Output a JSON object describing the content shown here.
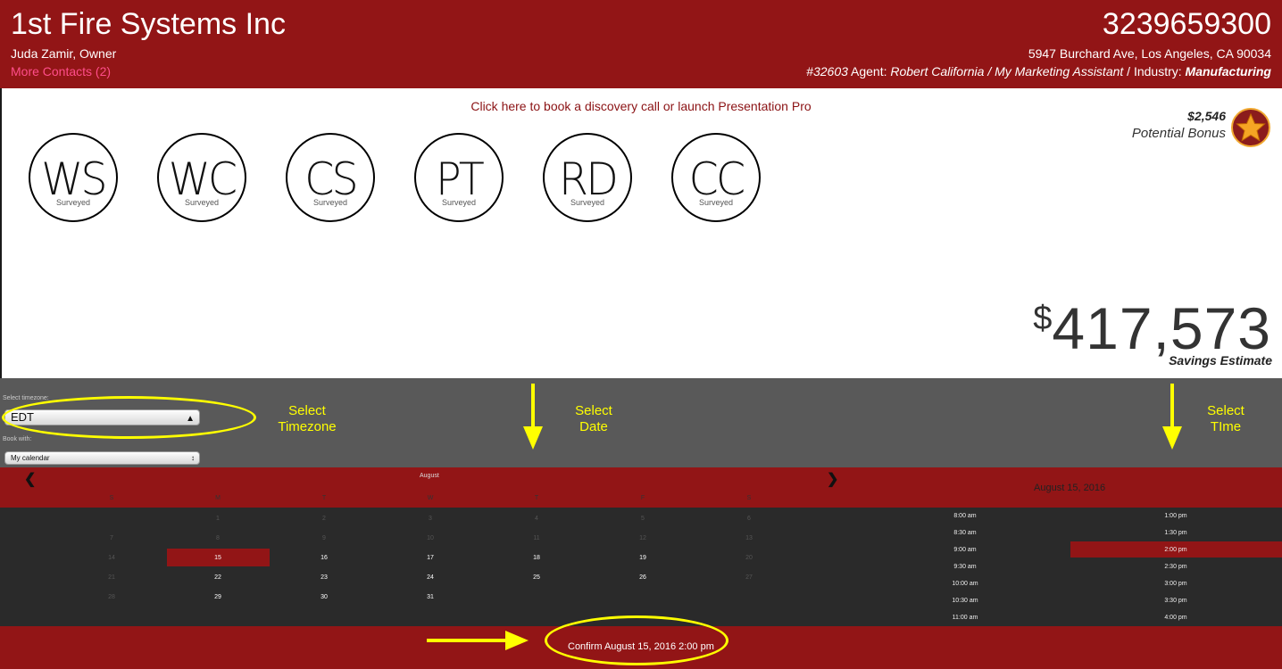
{
  "header": {
    "company_name": "1st Fire Systems Inc",
    "owner": "Juda Zamir, Owner",
    "more_contacts": "More Contacts (2)",
    "phone": "3239659300",
    "address": "5947 Burchard Ave, Los Angeles, CA 90034",
    "account_id": "#32603",
    "agent_label": " Agent: ",
    "agent_name": "Robert California / My Marketing Assistant",
    "industry_label": " / Industry: ",
    "industry": "Manufacturing"
  },
  "discovery_link": "Click here to book a discovery call or launch Presentation Pro",
  "bonus": {
    "amount": "$2,546",
    "label": "Potential Bonus"
  },
  "services": [
    {
      "abbr": "WS",
      "status": "Surveyed"
    },
    {
      "abbr": "WC",
      "status": "Surveyed"
    },
    {
      "abbr": "CS",
      "status": "Surveyed"
    },
    {
      "abbr": "PT",
      "status": "Surveyed"
    },
    {
      "abbr": "RD",
      "status": "Surveyed"
    },
    {
      "abbr": "CC",
      "status": "Surveyed"
    }
  ],
  "savings": {
    "currency": "$",
    "amount": "417,573",
    "label": "Savings Estimate"
  },
  "booking": {
    "timezone_label": "Select timezone:",
    "timezone_value": "EDT",
    "book_with_label": "Book with:",
    "book_with_value": "My calendar"
  },
  "annotations": {
    "timezone": [
      "Select",
      "Timezone"
    ],
    "date": [
      "Select",
      "Date"
    ],
    "time": [
      "Select",
      "TIme"
    ]
  },
  "calendar": {
    "month": "August",
    "weekdays": [
      "S",
      "M",
      "T",
      "W",
      "T",
      "F",
      "S"
    ],
    "weeks": [
      [
        "",
        "1",
        "2",
        "3",
        "4",
        "5",
        "6"
      ],
      [
        "7",
        "8",
        "9",
        "10",
        "11",
        "12",
        "13"
      ],
      [
        "14",
        "15",
        "16",
        "17",
        "18",
        "19",
        "20"
      ],
      [
        "21",
        "22",
        "23",
        "24",
        "25",
        "26",
        "27"
      ],
      [
        "28",
        "29",
        "30",
        "31",
        "",
        "",
        ""
      ]
    ],
    "selected_day": "15"
  },
  "time_slots": {
    "date_heading": "August 15, 2016",
    "morning": [
      "8:00 am",
      "8:30 am",
      "9:00 am",
      "9:30 am",
      "10:00 am",
      "10:30 am",
      "11:00 am"
    ],
    "afternoon": [
      "1:00 pm",
      "1:30 pm",
      "2:00 pm",
      "2:30 pm",
      "3:00 pm",
      "3:30 pm",
      "4:00 pm"
    ],
    "selected": "2:00 pm"
  },
  "confirm_label": "Confirm August 15, 2016 2:00 pm",
  "colors": {
    "brand_red": "#921516",
    "annotation_yellow": "#ffff00",
    "band_gray": "#595959",
    "calendar_dark": "#2a2a2a"
  },
  "icons": {
    "bonus_badge": "star-icon",
    "prev": "chevron-left-icon",
    "next": "chevron-right-icon",
    "annotation_arrow": "arrow-icon"
  }
}
